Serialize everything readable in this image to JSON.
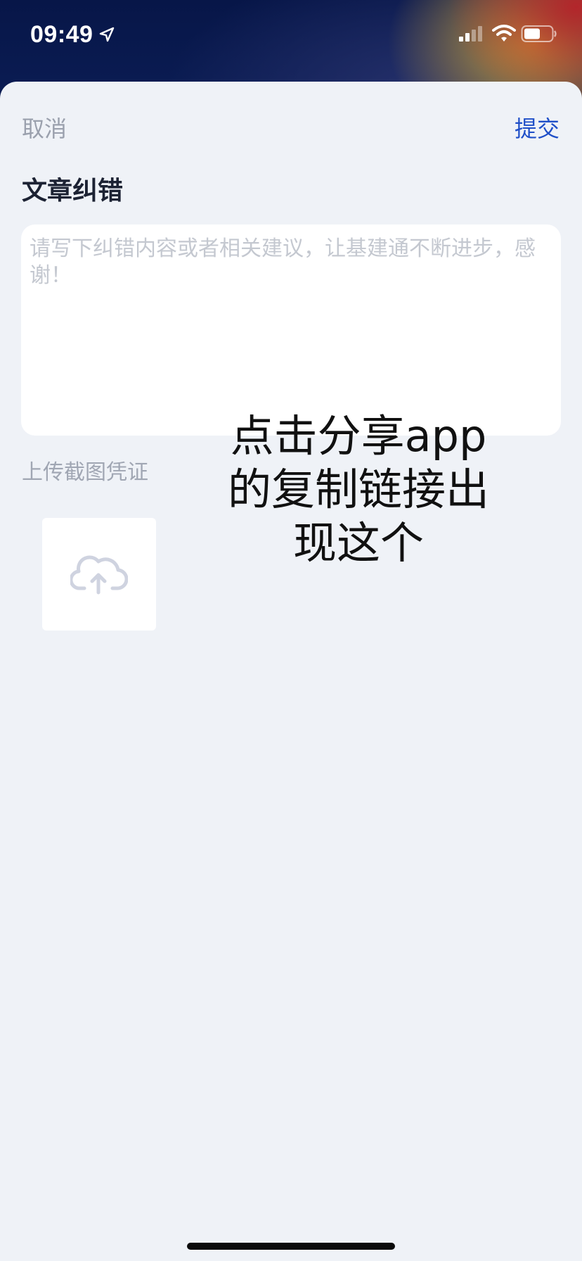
{
  "status_bar": {
    "time": "09:49",
    "icons": [
      "location-arrow-icon",
      "cellular-signal-icon",
      "wifi-icon",
      "battery-icon"
    ]
  },
  "nav": {
    "cancel_label": "取消",
    "submit_label": "提交"
  },
  "form": {
    "title": "文章纠错",
    "textarea_placeholder": "请写下纠错内容或者相关建议，让基建通不断进步，感谢！",
    "upload_label": "上传截图凭证",
    "upload_icon": "cloud-upload-icon"
  },
  "overlay_caption": "点击分享app\n的复制链接出\n现这个",
  "colors": {
    "sheet_background": "#eff2f7",
    "accent": "#1f4fc8",
    "muted_text": "#9aa0ad"
  }
}
